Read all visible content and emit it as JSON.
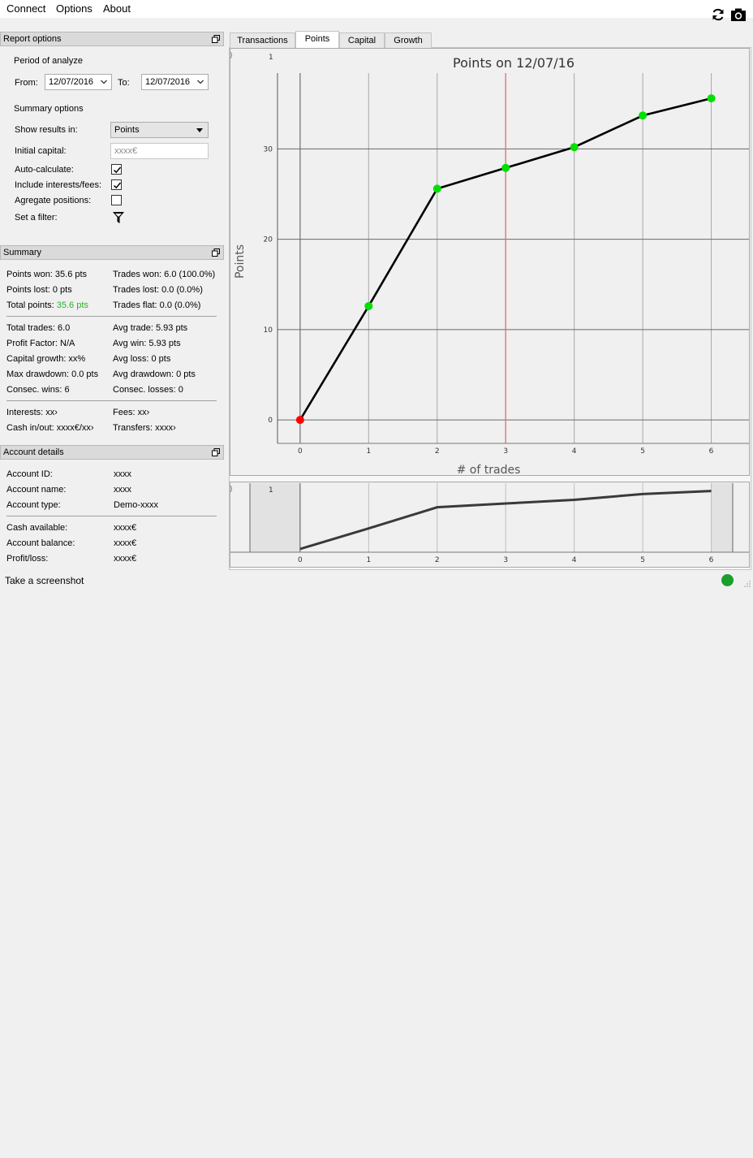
{
  "menu": {
    "items": [
      "Connect",
      "Options",
      "About"
    ]
  },
  "toolbar": {
    "refresh_icon": "refresh-icon",
    "screenshot_icon": "camera-icon"
  },
  "report_options": {
    "header": "Report options",
    "period_title": "Period of analyze",
    "from_label": "From:",
    "from_value": "12/07/2016",
    "to_label": "To:",
    "to_value": "12/07/2016",
    "summary_title": "Summary options",
    "show_results_label": "Show results in:",
    "show_results_value": "Points",
    "initial_capital_label": "Initial capital:",
    "initial_capital_placeholder": "xxxx€",
    "auto_calculate_label": "Auto-calculate:",
    "auto_calculate_checked": true,
    "include_fees_label": "Include interests/fees:",
    "include_fees_checked": true,
    "aggregate_label": "Agregate positions:",
    "aggregate_checked": false,
    "filter_label": "Set a filter:"
  },
  "summary": {
    "header": "Summary",
    "points_won": "Points won: 35.6 pts",
    "trades_won": "Trades won: 6.0 (100.0%)",
    "points_lost": "Points lost: 0 pts",
    "trades_lost": "Trades lost: 0.0 (0.0%)",
    "total_points_label": "Total points: ",
    "total_points_value": "35.6 pts",
    "trades_flat": "Trades flat: 0.0 (0.0%)",
    "total_trades": "Total trades: 6.0",
    "avg_trade": "Avg trade: 5.93 pts",
    "profit_factor": "Profit Factor: N/A",
    "avg_win": "Avg win: 5.93 pts",
    "capital_growth": "Capital growth: xx%",
    "avg_loss": "Avg loss: 0 pts",
    "max_drawdown": "Max drawdown: 0.0 pts",
    "avg_drawdown": "Avg drawdown: 0 pts",
    "consec_wins": "Consec. wins: 6",
    "consec_losses": "Consec. losses: 0",
    "interests": "Interests: xx›",
    "fees": "Fees: xx›",
    "cash_in_out": "Cash in/out: xxxx€/xx›",
    "transfers": "Transfers: xxxx›"
  },
  "account": {
    "header": "Account details",
    "id_label": "Account ID:",
    "id_value": "xxxx",
    "name_label": "Account name:",
    "name_value": "xxxx",
    "type_label": "Account type:",
    "type_value": "Demo-xxxx",
    "cash_label": "Cash available:",
    "cash_value": "xxxx€",
    "balance_label": "Account balance:",
    "balance_value": "xxxx€",
    "pl_label": "Profit/loss:",
    "pl_value": "xxxx€"
  },
  "tabs": [
    {
      "label": "Transactions",
      "active": false
    },
    {
      "label": "Points",
      "active": true
    },
    {
      "label": "Capital",
      "active": false
    },
    {
      "label": "Growth",
      "active": false
    }
  ],
  "status": {
    "text": "Take a screenshot",
    "indicator_color": "#1a9f2a"
  },
  "chart_data": [
    {
      "type": "line",
      "title": "Points on 12/07/16",
      "xlabel": "# of trades",
      "ylabel": "Points",
      "x": [
        0,
        1,
        2,
        3,
        4,
        5,
        6
      ],
      "values": [
        0,
        12.6,
        25.6,
        27.9,
        30.2,
        33.7,
        35.6
      ],
      "point_colors": [
        "#ff0000",
        "#00e000",
        "#00e000",
        "#00e000",
        "#00e000",
        "#00e000",
        "#00e000"
      ],
      "xticks": [
        "0",
        "1",
        "2",
        "3",
        "4",
        "5",
        "6"
      ],
      "yticks": [
        "0",
        "10",
        "20",
        "30"
      ],
      "xlim": [
        -0.33,
        6.55
      ],
      "ylim": [
        -2.6,
        38.4
      ],
      "marker_x": 3,
      "marker_color": "#e07070",
      "corner_label": "1",
      "grid": true
    },
    {
      "type": "line",
      "x": [
        0,
        1,
        2,
        3,
        4,
        5,
        6
      ],
      "values": [
        0,
        12.6,
        25.6,
        27.9,
        30.2,
        33.7,
        35.6
      ],
      "xticks": [
        "0",
        "1",
        "2",
        "3",
        "4",
        "5",
        "6"
      ],
      "xlim": [
        -0.33,
        6.55
      ],
      "ylim": [
        0,
        38.4
      ],
      "corner_label": "1",
      "grid": true
    }
  ]
}
